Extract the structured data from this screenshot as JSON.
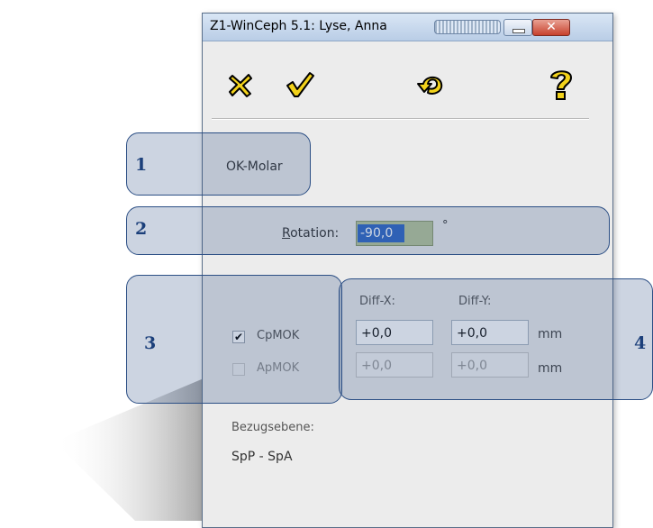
{
  "window": {
    "title": "Z1-WinCeph 5.1: Lyse, Anna",
    "close_symbol": "✕"
  },
  "toolbar": {
    "icons": [
      "cancel-x-icon",
      "confirm-check-icon",
      "undo-icon",
      "help-icon"
    ]
  },
  "tooth": {
    "name": "OK-Molar"
  },
  "rotation": {
    "label_accel": "R",
    "label_rest": "otation:",
    "value": "-90,0",
    "unit": "°"
  },
  "diff": {
    "header_x": "Diff-X:",
    "header_y": "Diff-Y:",
    "unit": "mm",
    "rows": [
      {
        "label": "CpMOK",
        "checked": true,
        "x": "+0,0",
        "y": "+0,0",
        "enabled": true
      },
      {
        "label": "ApMOK",
        "checked": false,
        "x": "+0,0",
        "y": "+0,0",
        "enabled": false
      }
    ]
  },
  "reference": {
    "label": "Bezugsebene:",
    "value": "SpP - SpA"
  },
  "callouts": [
    "1",
    "2",
    "3",
    "4"
  ],
  "colors": {
    "callout_fill": "#294a81",
    "callout_border": "#2c4f85",
    "callout_number": "#1b3f7a",
    "toolbar_icon_yellow": "#f2d21b",
    "selection_blue": "#3169c6"
  }
}
